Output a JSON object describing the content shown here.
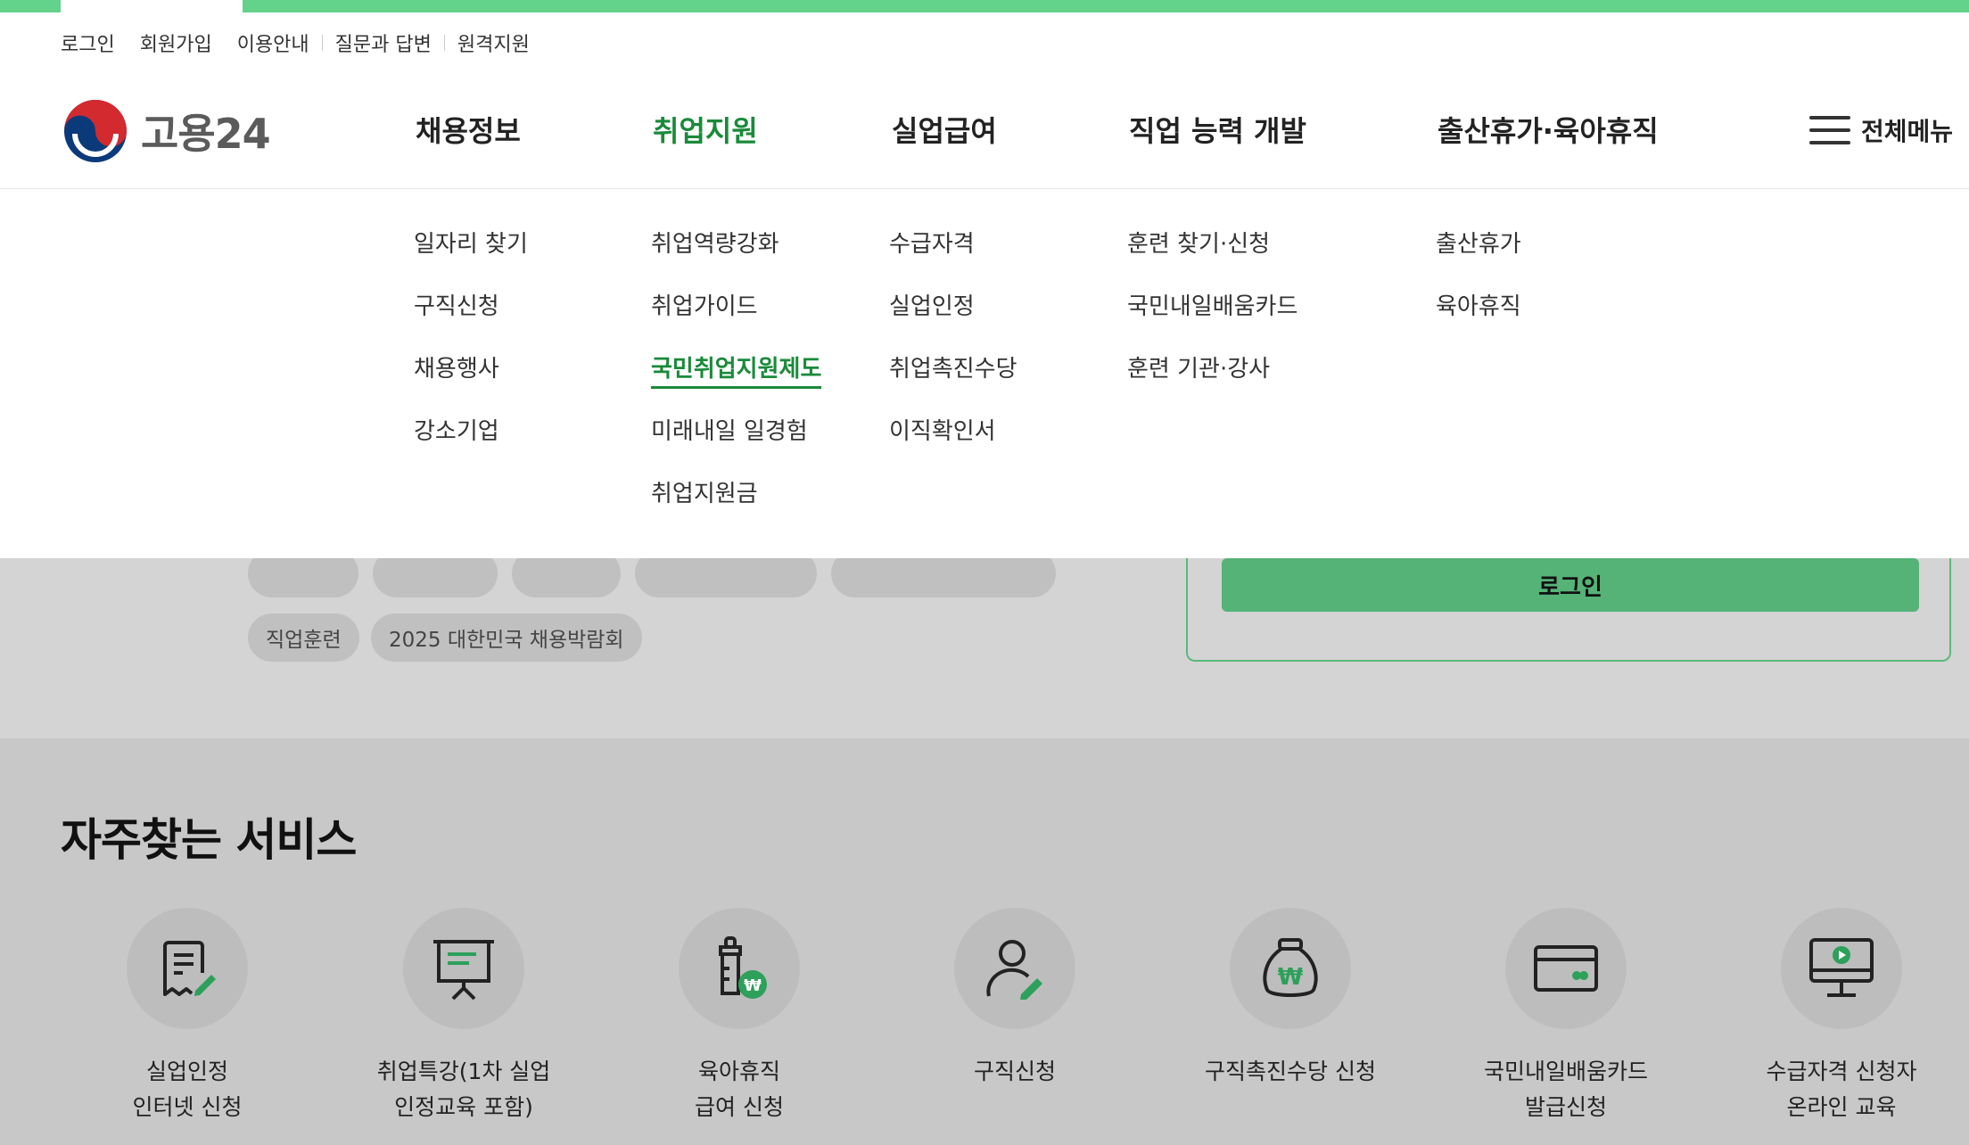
{
  "utility_links": [
    "로그인",
    "회원가입",
    "이용안내",
    "질문과 답변",
    "원격지원"
  ],
  "logo": {
    "text": "고용24"
  },
  "gnb": [
    {
      "label": "채용정보",
      "active": false
    },
    {
      "label": "취업지원",
      "active": true
    },
    {
      "label": "실업급여",
      "active": false
    },
    {
      "label": "직업 능력 개발",
      "active": false
    },
    {
      "label": "출산휴가·육아휴직",
      "active": false
    }
  ],
  "all_menu_label": "전체메뉴",
  "mega_menu": [
    [
      "일자리 찾기",
      "구직신청",
      "채용행사",
      "강소기업"
    ],
    [
      "취업역량강화",
      "취업가이드",
      "국민취업지원제도",
      "미래내일 일경험",
      "취업지원금"
    ],
    [
      "수급자격",
      "실업인정",
      "취업촉진수당",
      "이직확인서"
    ],
    [
      "훈련 찾기·신청",
      "국민내일배움카드",
      "훈련 기관·강사"
    ],
    [
      "출산휴가",
      "육아휴직"
    ]
  ],
  "mega_active_item": "국민취업지원제도",
  "keyword_chips": [
    "직업훈련",
    "2025 대한민국 채용박람회"
  ],
  "login_button": "로그인",
  "section_title": "자주찾는 서비스",
  "services": [
    {
      "name": "실업인정\n인터넷 신청",
      "icon": "document-edit-icon"
    },
    {
      "name": "취업특강(1차 실업\n인정교육 포함)",
      "icon": "presentation-board-icon"
    },
    {
      "name": "육아휴직\n급여 신청",
      "icon": "baby-bottle-won-icon"
    },
    {
      "name": "구직신청",
      "icon": "person-edit-icon"
    },
    {
      "name": "구직촉진수당 신청",
      "icon": "money-bag-won-icon"
    },
    {
      "name": "국민내일배움카드\n발급신청",
      "icon": "card-icon"
    },
    {
      "name": "수급자격 신청자\n온라인 교육",
      "icon": "monitor-play-icon"
    }
  ],
  "colors": {
    "brand_green": "#63d28a",
    "active_green": "#1a8a3a",
    "button_green": "#55b378"
  }
}
